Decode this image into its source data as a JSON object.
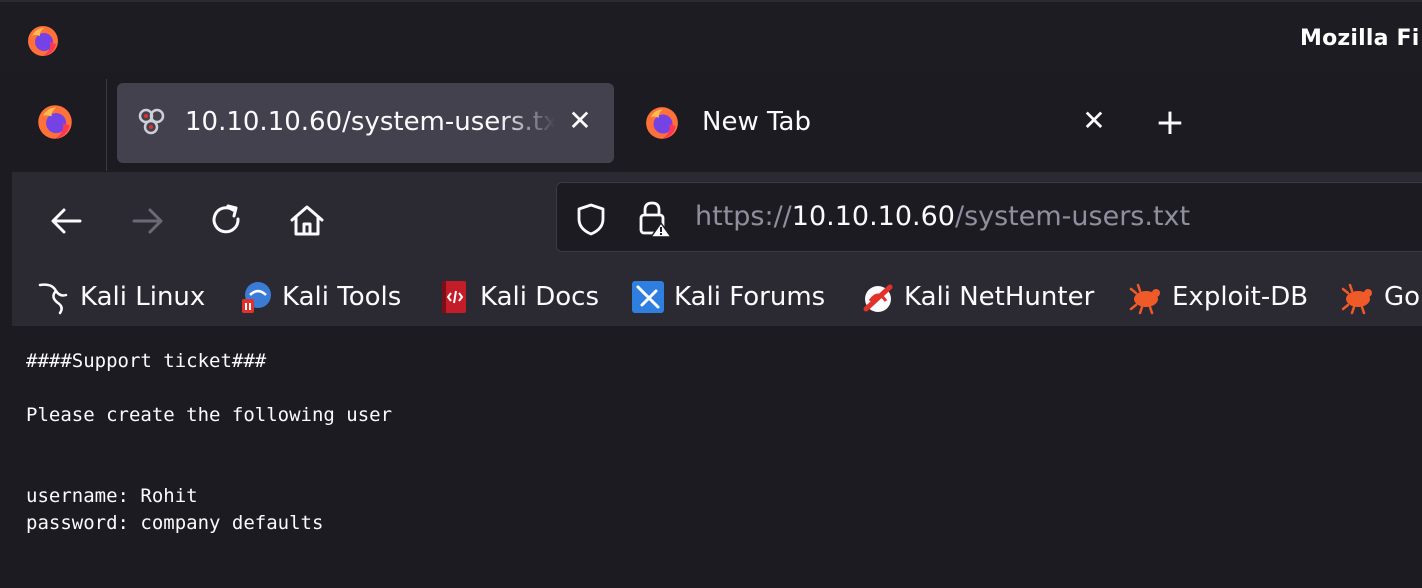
{
  "window": {
    "title": "Mozilla Fi"
  },
  "tabs": [
    {
      "label": "10.10.10.60/system-users.txt",
      "active": true,
      "favicon": "page-favicon-icon"
    },
    {
      "label": "New Tab",
      "active": false,
      "favicon": "firefox-icon"
    }
  ],
  "toolbar": {
    "back_icon": "back-arrow-icon",
    "forward_icon": "forward-arrow-icon",
    "reload_icon": "reload-icon",
    "home_icon": "home-icon"
  },
  "urlbar": {
    "scheme": "https://",
    "host": "10.10.10.60",
    "path": "/system-users.txt"
  },
  "bookmarks": [
    {
      "label": "Kali Linux",
      "icon": "kali-dragon-icon"
    },
    {
      "label": "Kali Tools",
      "icon": "kali-tools-icon"
    },
    {
      "label": "Kali Docs",
      "icon": "kali-docs-icon"
    },
    {
      "label": "Kali Forums",
      "icon": "kali-forums-icon"
    },
    {
      "label": "Kali NetHunter",
      "icon": "kali-nethunter-icon"
    },
    {
      "label": "Exploit-DB",
      "icon": "exploit-db-icon"
    },
    {
      "label": "Go",
      "icon": "exploit-db-icon"
    }
  ],
  "document": {
    "lines": [
      "####Support ticket###",
      "",
      "Please create the following user",
      "",
      "",
      "username: Rohit",
      "password: company defaults"
    ]
  },
  "colors": {
    "background": "#1c1b22",
    "toolbar": "#2b2a33",
    "active_tab": "#42414d",
    "text": "#fbfbfe",
    "url_dim": "#8f8f9d"
  }
}
